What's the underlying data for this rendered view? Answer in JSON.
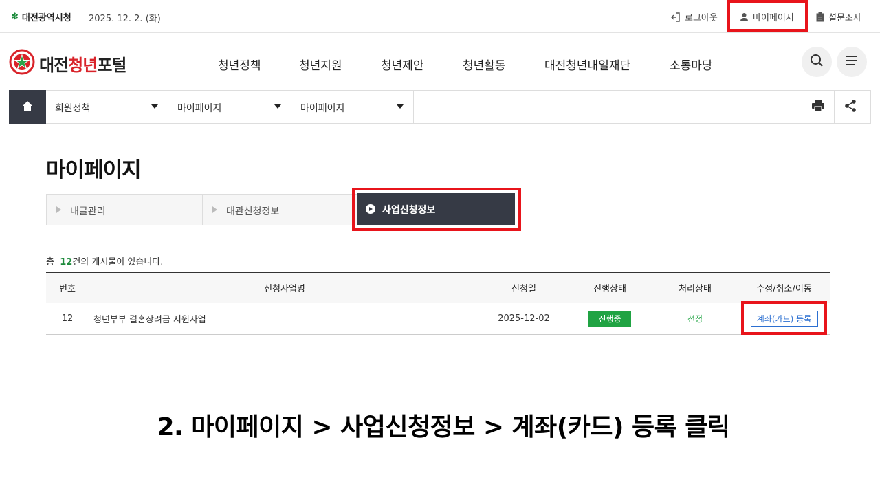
{
  "topbar": {
    "gov_name": "대전광역시청",
    "date": "2025. 12. 2. (화)",
    "logout": "로그아웃",
    "mypage": "마이페이지",
    "survey": "설문조사"
  },
  "header": {
    "logo_main": "대전",
    "logo_accent": "청년",
    "logo_tail": "포털",
    "nav": [
      "청년정책",
      "청년지원",
      "청년제안",
      "청년활동",
      "대전청년내일재단",
      "소통마당"
    ]
  },
  "location": {
    "items": [
      "회원정책",
      "마이페이지",
      "마이페이지"
    ]
  },
  "page_title": "마이페이지",
  "tabs": {
    "items": [
      "내글관리",
      "대관신청정보"
    ],
    "active": "사업신청정보"
  },
  "count": {
    "prefix": "총",
    "number": "12",
    "suffix": "건의 게시물이 있습니다."
  },
  "table": {
    "headers": [
      "번호",
      "신청사업명",
      "신청일",
      "진행상태",
      "처리상태",
      "수정/취소/이동"
    ],
    "rows": [
      {
        "no": "12",
        "name": "청년부부 결혼장려금 지원사업",
        "date": "2025-12-02",
        "progress": "진행중",
        "status": "선정",
        "action": "계좌(카드) 등록"
      }
    ]
  },
  "caption": "2. 마이페이지 > 사업신청정보 > 계좌(카드) 등록 클릭",
  "colors": {
    "highlight": "#e8141b",
    "dark": "#363a45",
    "green": "#20a343",
    "blue": "#2b6fd1",
    "brand_red": "#d9232a"
  }
}
